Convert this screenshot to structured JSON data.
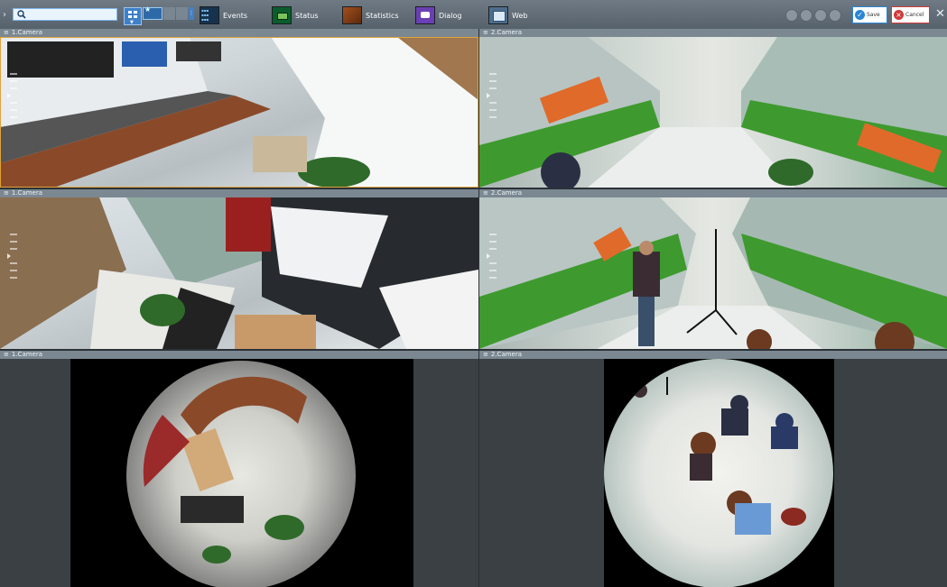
{
  "toolbar": {
    "search": {
      "value": "",
      "placeholder": ""
    },
    "events_label": "Events",
    "status_label": "Status",
    "statistics_label": "Statistics",
    "dialog_label": "Dialog",
    "web_label": "Web",
    "save_label": "Save",
    "cancel_label": "Cancel",
    "icons": [
      "search-icon",
      "layout-grid-icon",
      "events-icon",
      "status-icon",
      "statistics-icon",
      "dialog-icon",
      "web-icon",
      "globe-icon",
      "save-check-icon",
      "cancel-x-icon",
      "wrench-icon"
    ]
  },
  "cells": [
    {
      "title": "1.Camera"
    },
    {
      "title": "2.Camera"
    },
    {
      "title": "1.Camera"
    },
    {
      "title": "2.Camera"
    },
    {
      "title": "1.Camera"
    },
    {
      "title": "2.Camera"
    }
  ],
  "colors": {
    "toolbar": "#5f6a74",
    "accent": "#3f80c8",
    "selection": "#e0a33a",
    "save": "#2a86d6",
    "cancel": "#d03a3a"
  }
}
